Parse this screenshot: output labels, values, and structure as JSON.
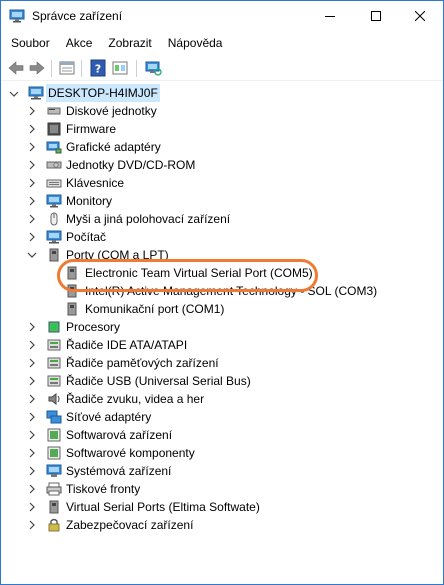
{
  "window": {
    "title": "Správce zařízení"
  },
  "menu": [
    "Soubor",
    "Akce",
    "Zobrazit",
    "Nápověda"
  ],
  "tree": {
    "root": "DESKTOP-H4IMJ0F",
    "categories": [
      {
        "label": "Diskové jednotky",
        "icon": "disk-drive-icon"
      },
      {
        "label": "Firmware",
        "icon": "firmware-icon"
      },
      {
        "label": "Grafické adaptéry",
        "icon": "display-adapter-icon"
      },
      {
        "label": "Jednotky DVD/CD-ROM",
        "icon": "dvd-drive-icon"
      },
      {
        "label": "Klávesnice",
        "icon": "keyboard-icon"
      },
      {
        "label": "Monitory",
        "icon": "monitor-icon"
      },
      {
        "label": "Myši a jiná polohovací zařízení",
        "icon": "mouse-icon"
      },
      {
        "label": "Počítač",
        "icon": "computer-icon"
      },
      {
        "label": "Porty (COM a LPT)",
        "icon": "port-icon"
      },
      {
        "label": "Procesory",
        "icon": "processor-icon"
      },
      {
        "label": "Řadiče IDE ATA/ATAPI",
        "icon": "ide-controller-icon"
      },
      {
        "label": "Řadiče paměťových zařízení",
        "icon": "storage-controller-icon"
      },
      {
        "label": "Řadiče USB (Universal Serial Bus)",
        "icon": "usb-controller-icon"
      },
      {
        "label": "Řadiče zvuku, videa a her",
        "icon": "sound-icon"
      },
      {
        "label": "Síťové adaptéry",
        "icon": "network-adapter-icon"
      },
      {
        "label": "Softwarová zařízení",
        "icon": "software-device-icon"
      },
      {
        "label": "Softwarové komponenty",
        "icon": "software-component-icon"
      },
      {
        "label": "Systémová zařízení",
        "icon": "system-device-icon"
      },
      {
        "label": "Tiskové fronty",
        "icon": "print-queue-icon"
      },
      {
        "label": "Virtual Serial Ports (Eltima Softwate)",
        "icon": "virtual-port-icon"
      },
      {
        "label": "Zabezpečovací zařízení",
        "icon": "security-device-icon"
      }
    ],
    "ports_children": [
      {
        "label": "Electronic Team Virtual Serial Port (COM5)"
      },
      {
        "label": "Intel(R) Active Management Technology - SOL (COM3)"
      },
      {
        "label": "Komunikační port (COM1)"
      }
    ]
  },
  "colors": {
    "highlight": "#f07a35",
    "selection": "#cce8ff"
  }
}
